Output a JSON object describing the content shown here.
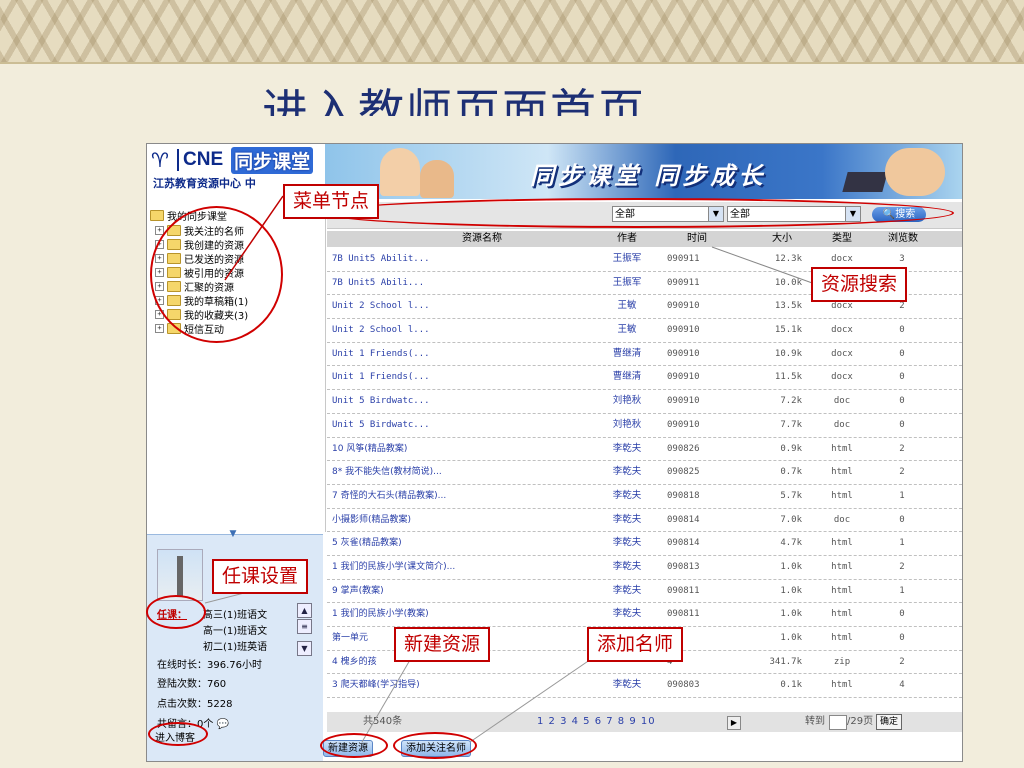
{
  "slide": {
    "title": "进入教师页面首页"
  },
  "header": {
    "logo_cne": "CNE",
    "logo_sync": "同步课堂",
    "org_name": "江苏教育资源中心  中",
    "slogan": "同步课堂  同步成长"
  },
  "tree": {
    "root": "我的同步课堂",
    "items": [
      "我关注的名师",
      "我创建的资源",
      "已发送的资源",
      "被引用的资源",
      "汇聚的资源",
      "我的草稿箱(1)",
      "我的收藏夹(3)",
      "短信互动"
    ]
  },
  "user_panel": {
    "course_label": "任课：",
    "courses": [
      "高三(1)班语文",
      "高一(1)班语文",
      "初二(1)班英语"
    ],
    "online_time": "在线时长：396.76小时",
    "login_count": "登陆次数：760",
    "click_count": "点击次数：5228",
    "messages": "共留言：0个",
    "blog_link": "进入博客"
  },
  "search": {
    "filter1": "全部",
    "filter2": "全部",
    "button": "搜索"
  },
  "table": {
    "headers": [
      "资源名称",
      "作者",
      "时间",
      "大小",
      "类型",
      "浏览数"
    ],
    "rows": [
      [
        "7B Unit5 Abilit...",
        "王振军",
        "090911",
        "12.3k",
        "docx",
        "3"
      ],
      [
        "7B Unit5 Abili...",
        "王振军",
        "090911",
        "10.0k",
        "docx",
        "3"
      ],
      [
        "Unit 2 School l...",
        "王敏",
        "090910",
        "13.5k",
        "docx",
        "2"
      ],
      [
        "Unit 2 School l...",
        "王敏",
        "090910",
        "15.1k",
        "docx",
        "0"
      ],
      [
        "Unit 1 Friends(...",
        "曹继清",
        "090910",
        "10.9k",
        "docx",
        "0"
      ],
      [
        "Unit 1 Friends(...",
        "曹继清",
        "090910",
        "11.5k",
        "docx",
        "0"
      ],
      [
        "Unit 5 Birdwatc...",
        "刘艳秋",
        "090910",
        "7.2k",
        "doc",
        "0"
      ],
      [
        "Unit 5 Birdwatc...",
        "刘艳秋",
        "090910",
        "7.7k",
        "doc",
        "0"
      ],
      [
        "10 风筝(精品教案)",
        "李乾夫",
        "090826",
        "0.9k",
        "html",
        "2"
      ],
      [
        "8* 我不能失信(教材简说)...",
        "李乾夫",
        "090825",
        "0.7k",
        "html",
        "2"
      ],
      [
        "7 奇怪的大石头(精品教案)...",
        "李乾夫",
        "090818",
        "5.7k",
        "html",
        "1"
      ],
      [
        "小摄影师(精品教案)",
        "李乾夫",
        "090814",
        "7.0k",
        "doc",
        "0"
      ],
      [
        "5 灰雀(精品教案)",
        "李乾夫",
        "090814",
        "4.7k",
        "html",
        "1"
      ],
      [
        "1 我们的民族小学(课文简介)...",
        "李乾夫",
        "090813",
        "1.0k",
        "html",
        "2"
      ],
      [
        "9 掌声(教案)",
        "李乾夫",
        "090811",
        "1.0k",
        "html",
        "1"
      ],
      [
        "1 我们的民族小学(教案)",
        "李乾夫",
        "090811",
        "1.0k",
        "html",
        "0"
      ],
      [
        "第一单元",
        "",
        "4",
        "1.0k",
        "html",
        "0"
      ],
      [
        "4 槐乡的孩",
        "",
        "4",
        "341.7k",
        "zip",
        "2"
      ],
      [
        "3 爬天都峰(学习指导)",
        "李乾夫",
        "090803",
        "0.1k",
        "html",
        "4"
      ]
    ]
  },
  "pager": {
    "count": "共540条",
    "pages": "1 2 3 4 5 6 7 8 9 10",
    "goto": "转到",
    "total": "/29页",
    "ok": "确定"
  },
  "buttons": {
    "new_resource": "新建资源",
    "add_teacher": "添加关注名师"
  },
  "annotations": {
    "menu_node": "菜单节点",
    "resource_search": "资源搜索",
    "course_setting": "任课设置",
    "new_resource": "新建资源",
    "add_teacher": "添加名师"
  },
  "colors": {
    "annotation_red": "#c00000",
    "link_blue": "#2a3fa8",
    "title_blue": "#1d2f74"
  }
}
